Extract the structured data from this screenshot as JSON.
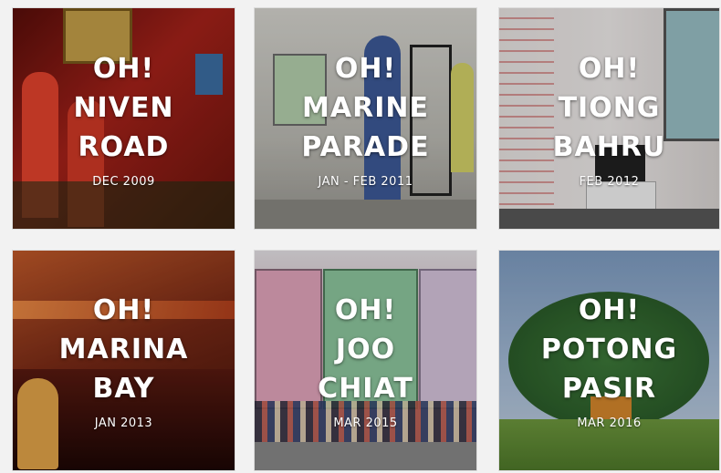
{
  "tiles": [
    {
      "id": "niven-road",
      "line1": "OH!",
      "line2": "NIVEN",
      "line3": "ROAD",
      "date": "DEC 2009"
    },
    {
      "id": "marine-parade",
      "line1": "OH!",
      "line2": "MARINE",
      "line3": "PARADE",
      "date": "JAN - FEB 2011"
    },
    {
      "id": "tiong-bahru",
      "line1": "OH!",
      "line2": "TIONG",
      "line3": "BAHRU",
      "date": "FEB 2012"
    },
    {
      "id": "marina-bay",
      "line1": "OH!",
      "line2": "MARINA",
      "line3": "BAY",
      "date": "JAN 2013"
    },
    {
      "id": "joo-chiat",
      "line1": "OH!",
      "line2": "JOO",
      "line3": "CHIAT",
      "date": "MAR 2015"
    },
    {
      "id": "potong-pasir",
      "line1": "OH!",
      "line2": "POTONG",
      "line3": "PASIR",
      "date": "MAR 2016"
    }
  ],
  "colors": {
    "niven_bg": "#8e1a14",
    "marine_bg": "#c9c8c2",
    "tiong_bg": "#e6e1df",
    "marina_bg": "#7a2a16",
    "joo_bg": "#d7b7c2",
    "potong_bg": "#8aa6c9"
  }
}
